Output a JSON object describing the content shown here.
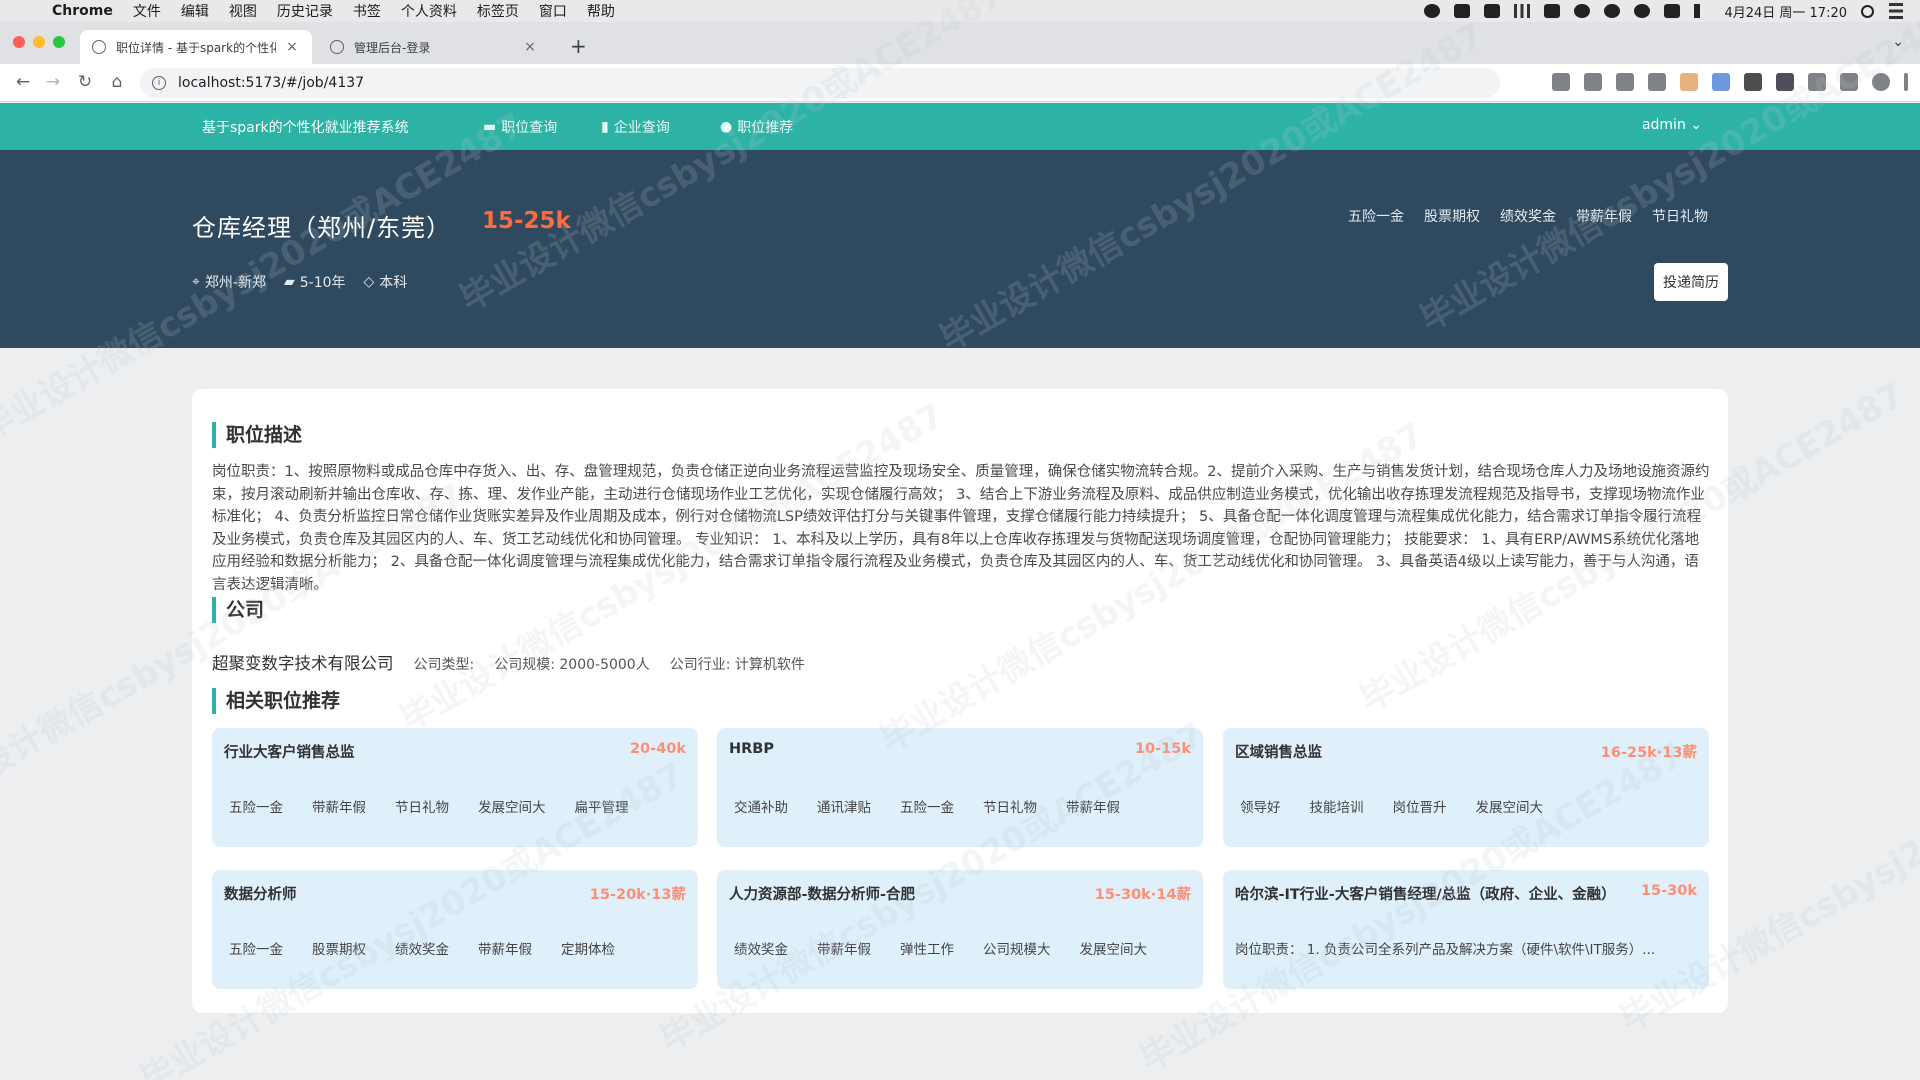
{
  "macbar": {
    "apple": "",
    "menu": [
      "Chrome",
      "文件",
      "编辑",
      "视图",
      "历史记录",
      "书签",
      "个人资料",
      "标签页",
      "窗口",
      "帮助"
    ],
    "clock": "4月24日 周一 17:20"
  },
  "browser": {
    "tabs": [
      {
        "title": "职位详情 - 基于spark的个性化就",
        "close": "×"
      },
      {
        "title": "管理后台-登录",
        "close": "×"
      }
    ],
    "new_tab": "+",
    "tab_menu": "⌄",
    "url": "localhost:5173/#/job/4137",
    "info_glyph": "i"
  },
  "nav": {
    "brand": "基于spark的个性化就业推荐系统",
    "links": [
      {
        "icon": "▬",
        "label": "职位查询"
      },
      {
        "icon": "▮",
        "label": "企业查询"
      },
      {
        "icon": "●",
        "label": "职位推荐"
      }
    ],
    "user": "admin ⌄"
  },
  "job": {
    "title": "仓库经理（郑州/东莞）",
    "salary": "15-25k",
    "location": "郑州-新郑",
    "experience": "5-10年",
    "education": "本科",
    "welfare": [
      "五险一金",
      "股票期权",
      "绩效奖金",
      "带薪年假",
      "节日礼物"
    ],
    "apply_label": "投递简历"
  },
  "sections": {
    "description_title": "职位描述",
    "description": "岗位职责：1、按照原物料或成品仓库中存货入、出、存、盘管理规范，负责仓储正逆向业务流程运营监控及现场安全、质量管理，确保仓储实物流转合规。2、提前介入采购、生产与销售发货计划，结合现场仓库人力及场地设施资源约束，按月滚动刷新并输出仓库收、存、拣、理、发作业产能，主动进行仓储现场作业工艺优化，实现仓储履行高效； 3、结合上下游业务流程及原料、成品供应制造业务模式，优化输出收存拣理发流程规范及指导书，支撑现场物流作业标准化； 4、负责分析监控日常仓储作业货账实差异及作业周期及成本，例行对仓储物流LSP绩效评估打分与关键事件管理，支撑仓储履行能力持续提升； 5、具备仓配一体化调度管理与流程集成优化能力，结合需求订单指令履行流程及业务模式，负责仓库及其园区内的人、车、货工艺动线优化和协同管理。 专业知识： 1、本科及以上学历，具有8年以上仓库收存拣理发与货物配送现场调度管理，仓配协同管理能力； 技能要求： 1、具有ERP/AWMS系统优化落地应用经验和数据分析能力； 2、具备仓配一体化调度管理与流程集成优化能力，结合需求订单指令履行流程及业务模式，负责仓库及其园区内的人、车、货工艺动线优化和协同管理。 3、具备英语4级以上读写能力，善于与人沟通，语言表达逻辑清晰。",
    "company_title": "公司",
    "company_name": "超聚变数字技术有限公司",
    "company_type": "公司类型:",
    "company_scale": "公司规模: 2000-5000人",
    "company_industry": "公司行业: 计算机软件",
    "related_title": "相关职位推荐"
  },
  "related": [
    {
      "title": "行业大客户销售总监",
      "salary": "20-40k",
      "tags": [
        "五险一金",
        "带薪年假",
        "节日礼物",
        "发展空间大",
        "扁平管理"
      ]
    },
    {
      "title": "HRBP",
      "salary": "10-15k",
      "tags": [
        "交通补助",
        "通讯津贴",
        "五险一金",
        "节日礼物",
        "带薪年假"
      ]
    },
    {
      "title": "区域销售总监",
      "salary": "16-25k·13薪",
      "tags": [
        "领导好",
        "技能培训",
        "岗位晋升",
        "发展空间大"
      ]
    },
    {
      "title": "数据分析师",
      "salary": "15-20k·13薪",
      "tags": [
        "五险一金",
        "股票期权",
        "绩效奖金",
        "带薪年假",
        "定期体检"
      ]
    },
    {
      "title": "人力资源部-数据分析师-合肥",
      "salary": "15-30k·14薪",
      "tags": [
        "绩效奖金",
        "带薪年假",
        "弹性工作",
        "公司规模大",
        "发展空间大"
      ]
    },
    {
      "title": "哈尔滨-IT行业-大客户销售经理/总监（政府、企业、金融）",
      "salary": "15-30k",
      "desc": "岗位职责： 1. 负责公司全系列产品及解决方案（硬件\\软件\\IT服务）..."
    }
  ],
  "watermark": "毕业设计微信csbysj2020或ACE2487",
  "colors": {
    "teal": "#2db3a6",
    "header": "#2f4a5f",
    "salary": "#ff6b3d",
    "card": "#dff0fb"
  }
}
